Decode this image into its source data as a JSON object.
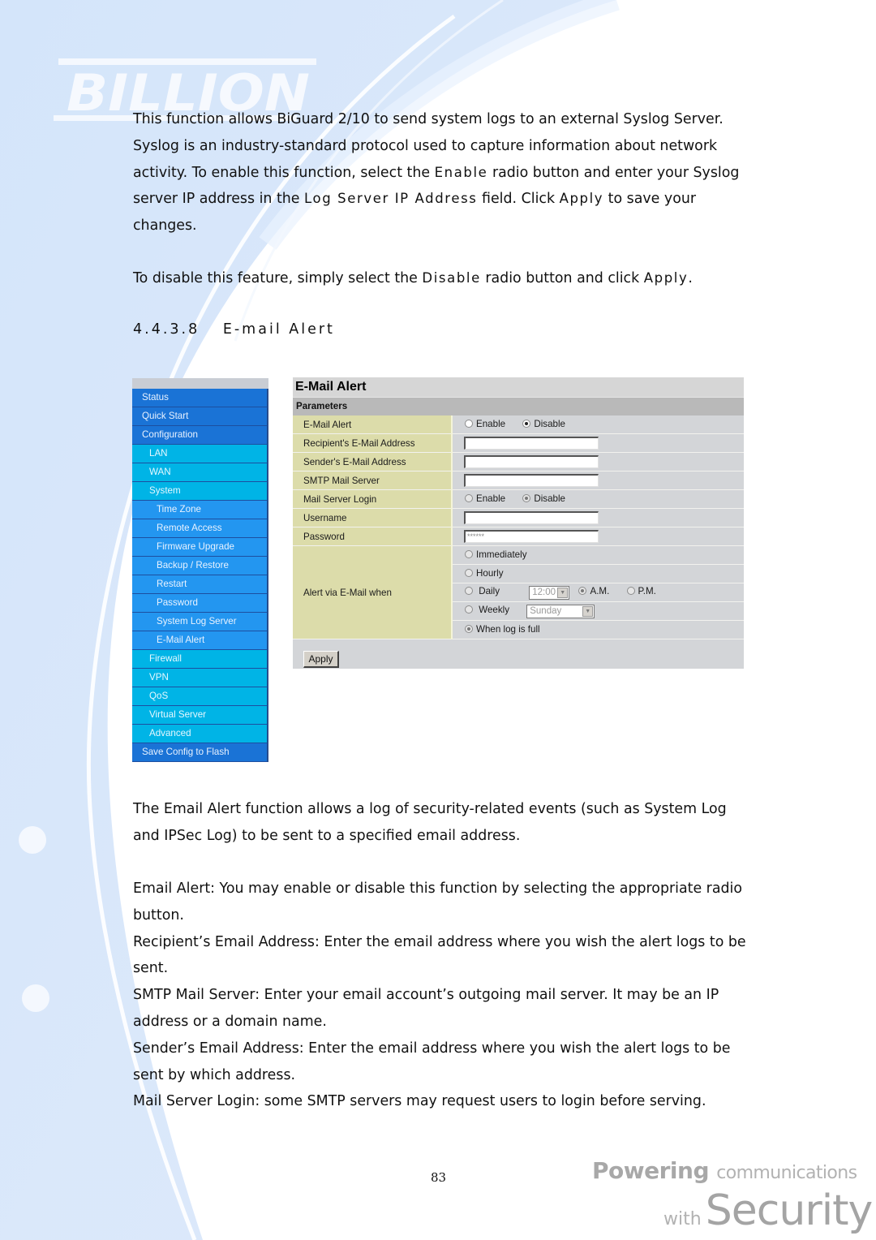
{
  "brand": {
    "logo_text": "BILLION"
  },
  "intro": {
    "p1": [
      {
        "t": "This function allows BiGuard 2/10 to send system logs to an external Syslog Server. Syslog is an industry-standard protocol used to capture information about network activity. To enable this function, select the "
      },
      {
        "t": "Enable",
        "mono": true
      },
      {
        "t": " radio button and enter your Syslog server IP address in the "
      },
      {
        "t": "Log Server IP Address",
        "mono": true
      },
      {
        "t": " field. Click "
      },
      {
        "t": "Apply",
        "mono": true
      },
      {
        "t": " to save your changes."
      }
    ],
    "p2": [
      {
        "t": "To disable this feature, simply select the "
      },
      {
        "t": "Disable",
        "mono": true
      },
      {
        "t": " radio button and click "
      },
      {
        "t": "Apply",
        "mono": true
      },
      {
        "t": "."
      }
    ]
  },
  "section": {
    "number": "4.4.3.8",
    "title": "E-mail Alert"
  },
  "nav": {
    "items": [
      {
        "label": "Status",
        "level": 0
      },
      {
        "label": "Quick Start",
        "level": 0
      },
      {
        "label": "Configuration",
        "level": 0
      },
      {
        "label": "LAN",
        "level": 1
      },
      {
        "label": "WAN",
        "level": 1
      },
      {
        "label": "System",
        "level": 1
      },
      {
        "label": "Time Zone",
        "level": 2
      },
      {
        "label": "Remote Access",
        "level": 2
      },
      {
        "label": "Firmware Upgrade",
        "level": 2
      },
      {
        "label": "Backup / Restore",
        "level": 2
      },
      {
        "label": "Restart",
        "level": 2
      },
      {
        "label": "Password",
        "level": 2
      },
      {
        "label": "System Log Server",
        "level": 2
      },
      {
        "label": "E-Mail Alert",
        "level": 2
      },
      {
        "label": "Firewall",
        "level": 1
      },
      {
        "label": "VPN",
        "level": 1
      },
      {
        "label": "QoS",
        "level": 1
      },
      {
        "label": "Virtual Server",
        "level": 1
      },
      {
        "label": "Advanced",
        "level": 1
      },
      {
        "label": "Save Config to Flash",
        "level": 0
      }
    ]
  },
  "form": {
    "title": "E-Mail Alert",
    "subtitle": "Parameters",
    "email_alert": {
      "label": "E-Mail Alert",
      "options": [
        "Enable",
        "Disable"
      ],
      "selected": "Disable"
    },
    "recipient": {
      "label": "Recipient's E-Mail Address",
      "value": ""
    },
    "sender": {
      "label": "Sender's E-Mail Address",
      "value": ""
    },
    "smtp": {
      "label": "SMTP Mail Server",
      "value": ""
    },
    "login": {
      "label": "Mail Server Login",
      "options": [
        "Enable",
        "Disable"
      ],
      "selected": "Disable"
    },
    "username": {
      "label": "Username",
      "value": ""
    },
    "password": {
      "label": "Password",
      "value": "******"
    },
    "alert_when": {
      "label": "Alert via E-Mail when",
      "immediately": "Immediately",
      "hourly": "Hourly",
      "daily": "Daily",
      "daily_time": "12:00",
      "am": "A.M.",
      "pm": "P.M.",
      "ampm_selected": "A.M.",
      "weekly": "Weekly",
      "weekly_day": "Sunday",
      "when_full": "When log is full",
      "selected": "When log is full"
    },
    "apply_label": "Apply"
  },
  "description": {
    "p3": "The Email Alert function allows a log of security-related events (such as System Log and IPSec Log) to be sent to a specified email address.",
    "p4": [
      "Email Alert: You may enable or disable this function by selecting the appropriate radio button.",
      "Recipient’s Email Address: Enter the email address where you wish the alert logs to be sent.",
      "SMTP Mail Server: Enter your email account’s outgoing mail server. It may be an IP address or a domain name.",
      "Sender’s Email Address: Enter the email address where you wish the alert logs to be sent by which address.",
      "Mail Server Login: some SMTP servers may request users to login before serving."
    ]
  },
  "footer": {
    "page_number": "83",
    "tagline_bold": "Powering",
    "tagline_rest": "communications",
    "tagline_with": "with",
    "tagline_security": "Security"
  },
  "colors": {
    "nav_level0": "#1a73d6",
    "nav_level1": "#00b4e6",
    "nav_level2": "#2396f0",
    "form_label_bg": "#dcdcaa",
    "form_value_bg": "#d3d5d8",
    "page_bg_tint": "#d9e8fb"
  }
}
